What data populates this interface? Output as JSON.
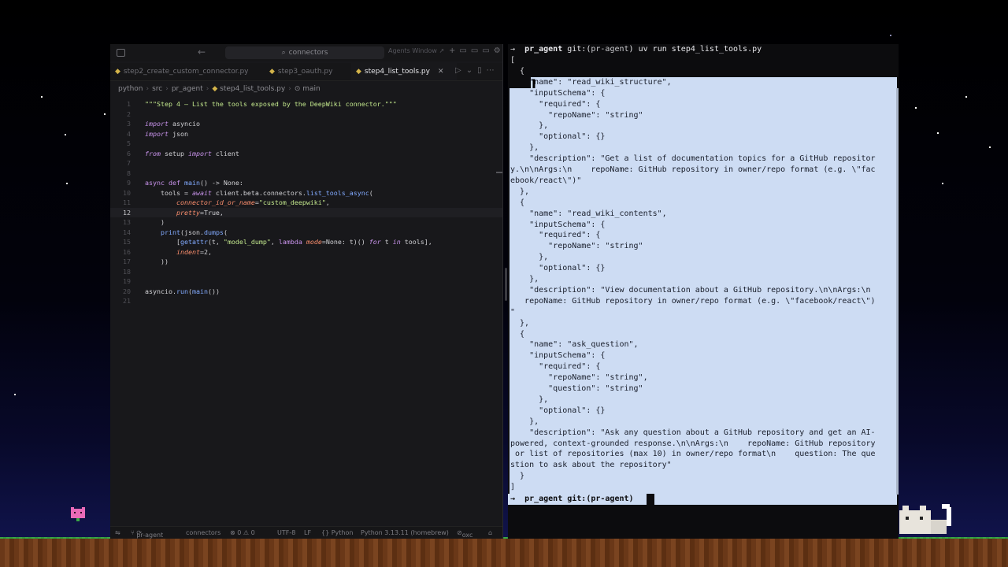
{
  "editor": {
    "search": "connectors",
    "agents_window": "Agents Window ↗",
    "tabs": [
      {
        "label": "step2_create_custom_connector.py",
        "active": false
      },
      {
        "label": "step3_oauth.py",
        "active": false
      },
      {
        "label": "step4_list_tools.py",
        "active": true
      }
    ],
    "breadcrumb": [
      "python",
      "src",
      "pr_agent",
      "step4_list_tools.py",
      "main"
    ],
    "current_line": 12,
    "status": {
      "branch": "pr-agent",
      "connectors": "connectors",
      "problems": "⊗ 0 ⚠ 0",
      "encoding": "UTF-8",
      "eol": "LF",
      "language": "{} Python",
      "interpreter": "Python 3.13.11 (homebrew)",
      "extra": "oxc"
    }
  },
  "terminal": {
    "prompt_user": "pr_agent",
    "prompt_git": "git:(",
    "prompt_branch": "pr-agent",
    "prompt_close": ")",
    "command": "uv run step4_list_tools.py",
    "output_lines": [
      "[",
      "  {",
      "    \"name\": \"read_wiki_structure\",",
      "    \"inputSchema\": {",
      "      \"required\": {",
      "        \"repoName\": \"string\"",
      "      },",
      "      \"optional\": {}",
      "    },",
      "    \"description\": \"Get a list of documentation topics for a GitHub repositor",
      "y.\\n\\nArgs:\\n    repoName: GitHub repository in owner/repo format (e.g. \\\"fac",
      "ebook/react\\\")\"",
      "  },",
      "  {",
      "    \"name\": \"read_wiki_contents\",",
      "    \"inputSchema\": {",
      "      \"required\": {",
      "        \"repoName\": \"string\"",
      "      },",
      "      \"optional\": {}",
      "    },",
      "    \"description\": \"View documentation about a GitHub repository.\\n\\nArgs:\\n",
      "   repoName: GitHub repository in owner/repo format (e.g. \\\"facebook/react\\\")",
      "\"",
      "  },",
      "  {",
      "    \"name\": \"ask_question\",",
      "    \"inputSchema\": {",
      "      \"required\": {",
      "        \"repoName\": \"string\",",
      "        \"question\": \"string\"",
      "      },",
      "      \"optional\": {}",
      "    },",
      "    \"description\": \"Ask any question about a GitHub repository and get an AI-",
      "powered, context-grounded response.\\n\\nArgs:\\n    repoName: GitHub repository",
      " or list of repositories (max 10) in owner/repo format\\n    question: The que",
      "stion to ask about the repository\"",
      "  }",
      "]"
    ],
    "final_prompt": "pr_agent git:(pr-agent)"
  }
}
